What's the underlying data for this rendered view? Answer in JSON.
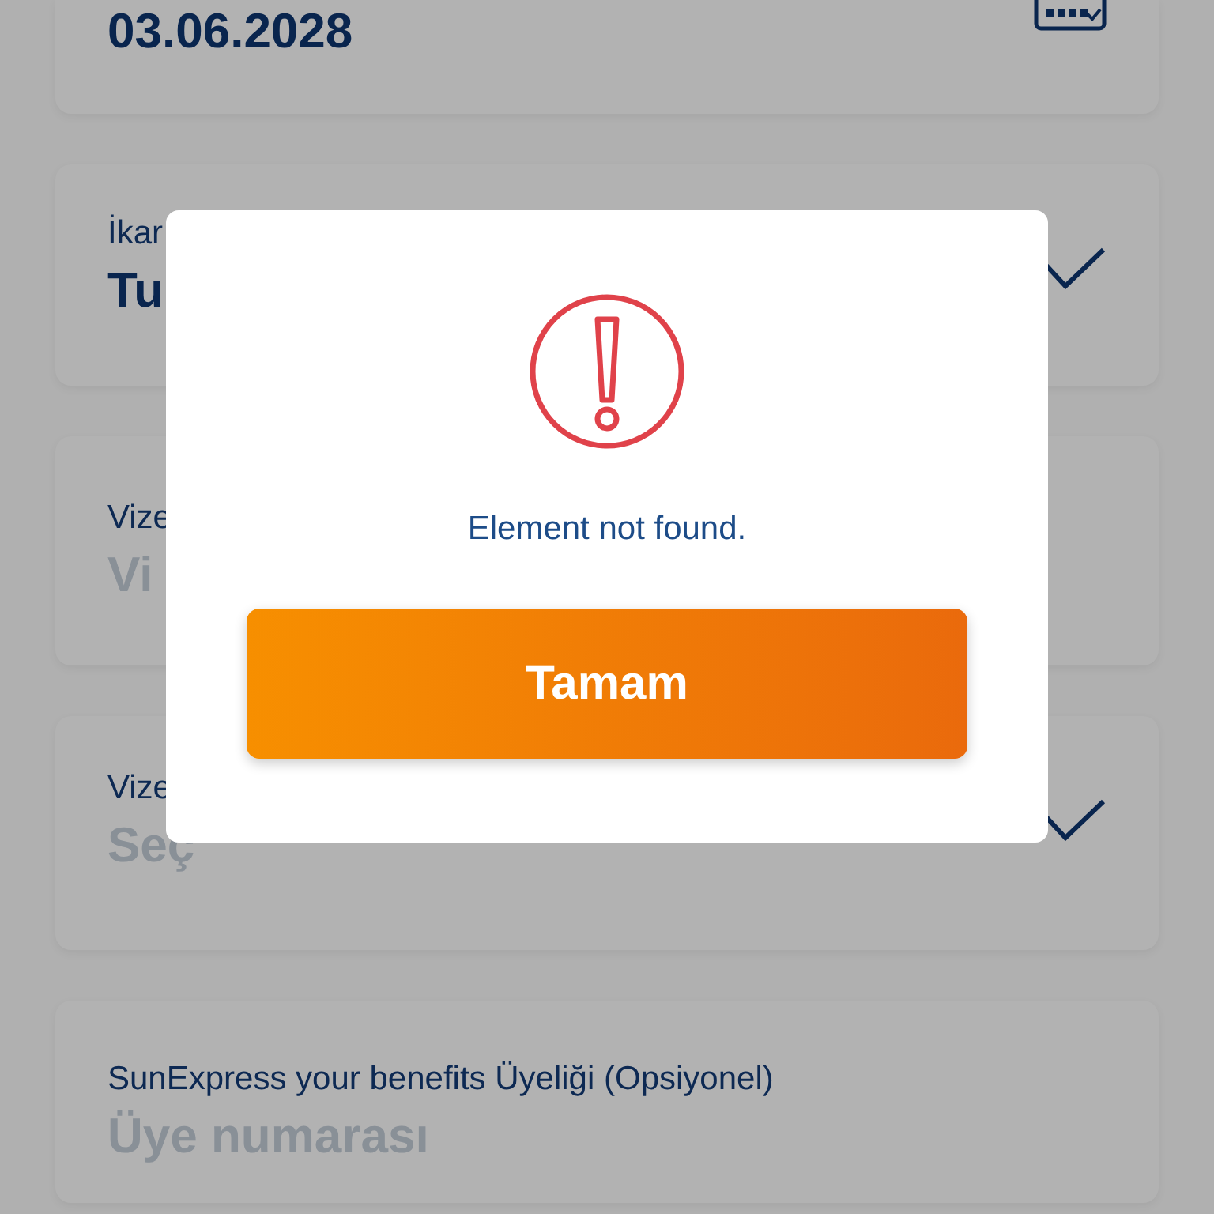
{
  "fields": [
    {
      "kind": "date",
      "value": "03.06.2028"
    },
    {
      "kind": "select",
      "label": "İkar",
      "value": "Tu"
    },
    {
      "kind": "text",
      "label": "Vize",
      "placeholder": "Vi"
    },
    {
      "kind": "select",
      "label": "Vize",
      "placeholder": "Seç"
    },
    {
      "kind": "text",
      "label": "SunExpress your benefits Üyeliği (Opsiyonel)",
      "placeholder": "Üye numarası"
    }
  ],
  "dialog": {
    "message": "Element not found.",
    "button": "Tamam"
  }
}
